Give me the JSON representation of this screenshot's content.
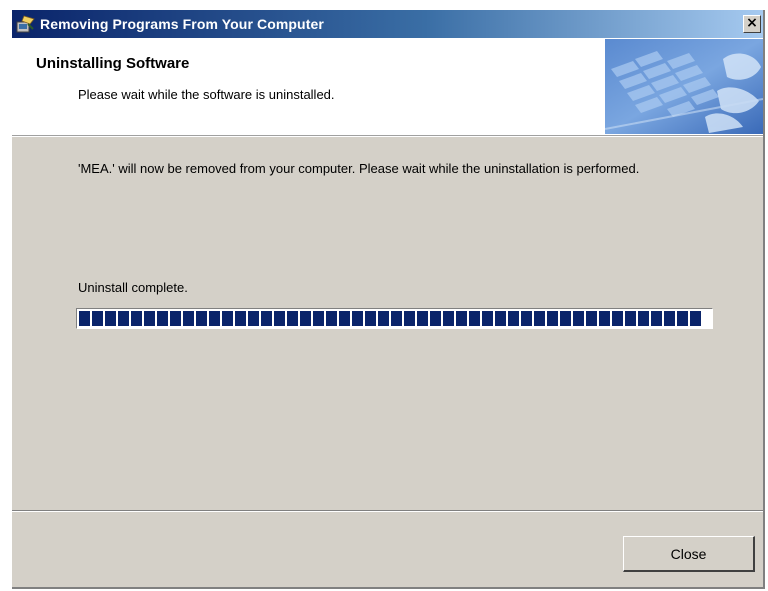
{
  "window": {
    "title": "Removing Programs From Your Computer",
    "close_glyph": "×",
    "icon": "installer-icon"
  },
  "header": {
    "title": "Uninstalling Software",
    "subtitle": "Please wait while the software is uninstalled.",
    "image": "keyboard-banner-image"
  },
  "body": {
    "message": "'MEA.' will now be removed from your computer. Please wait while the uninstallation is performed.",
    "status": "Uninstall complete."
  },
  "progress": {
    "value_percent": 100,
    "fill_color": "#0a246a"
  },
  "footer": {
    "close_label": "Close"
  },
  "colors": {
    "dialog_face": "#d4d0c8",
    "title_gradient_start": "#0a246a",
    "title_gradient_end": "#a6caf0"
  }
}
